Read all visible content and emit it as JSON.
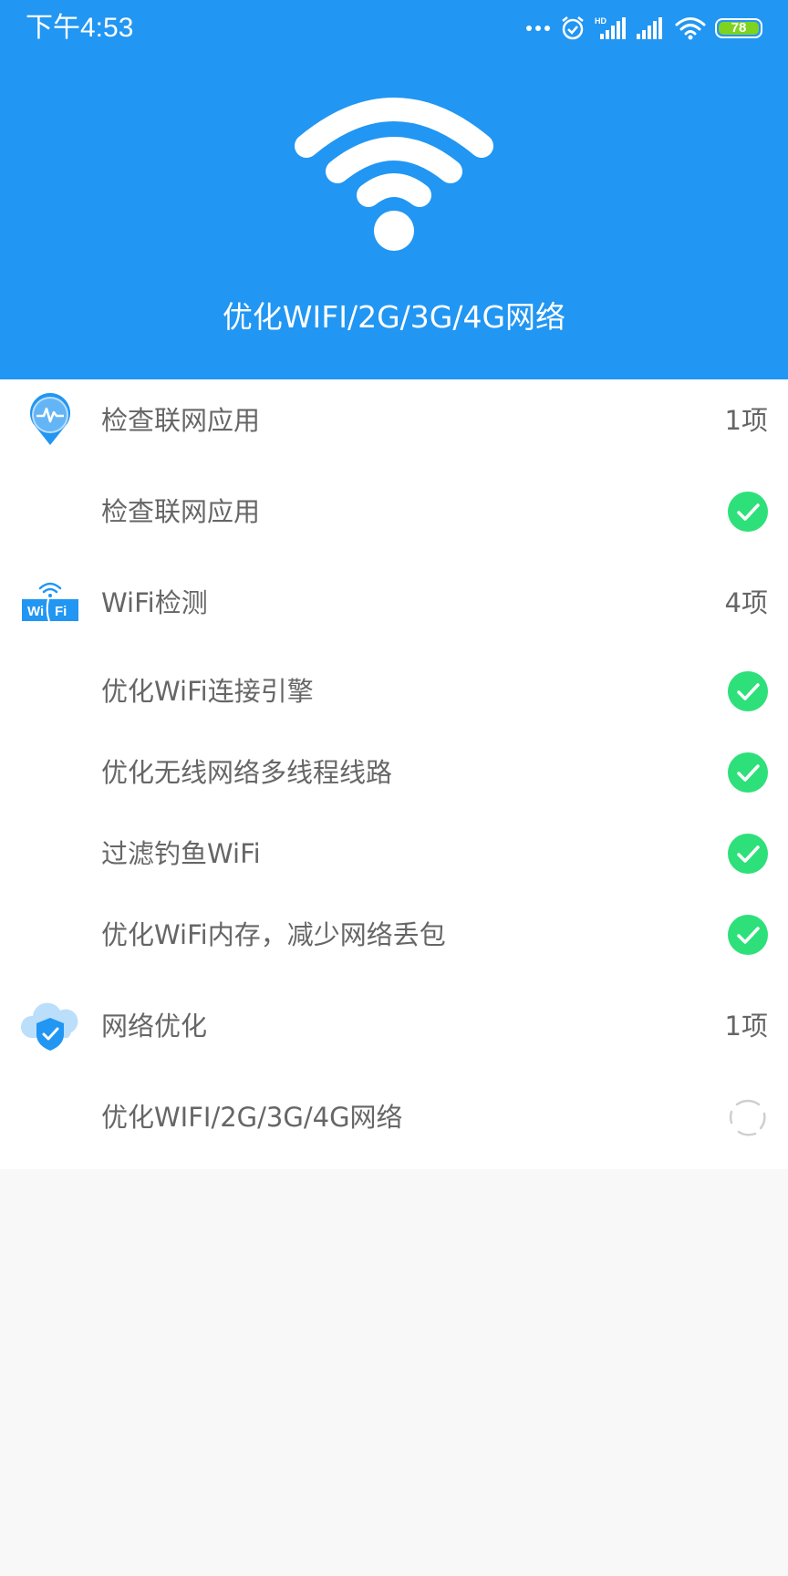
{
  "status_bar": {
    "time": "下午4:53",
    "battery_level": "78",
    "battery_color": "#7ED321"
  },
  "header": {
    "title": "优化WIFI/2G/3G/4G网络",
    "background_color": "#2196F3",
    "icon": "wifi-icon"
  },
  "sections": [
    {
      "icon": "location-pulse-icon",
      "title": "检查联网应用",
      "count": "1项",
      "items": [
        {
          "label": "检查联网应用",
          "status": "done"
        }
      ]
    },
    {
      "icon": "wifi-badge-icon",
      "title": "WiFi检测",
      "count": "4项",
      "items": [
        {
          "label": "优化WiFi连接引擎",
          "status": "done"
        },
        {
          "label": "优化无线网络多线程线路",
          "status": "done"
        },
        {
          "label": "过滤钓鱼WiFi",
          "status": "done"
        },
        {
          "label": "优化WiFi内存，减少网络丢包",
          "status": "done"
        }
      ]
    },
    {
      "icon": "cloud-shield-icon",
      "title": "网络优化",
      "count": "1项",
      "items": [
        {
          "label": "优化WIFI/2G/3G/4G网络",
          "status": "loading"
        }
      ]
    }
  ],
  "colors": {
    "accent": "#2196F3",
    "check_green": "#2EE07A",
    "text": "#666666"
  }
}
